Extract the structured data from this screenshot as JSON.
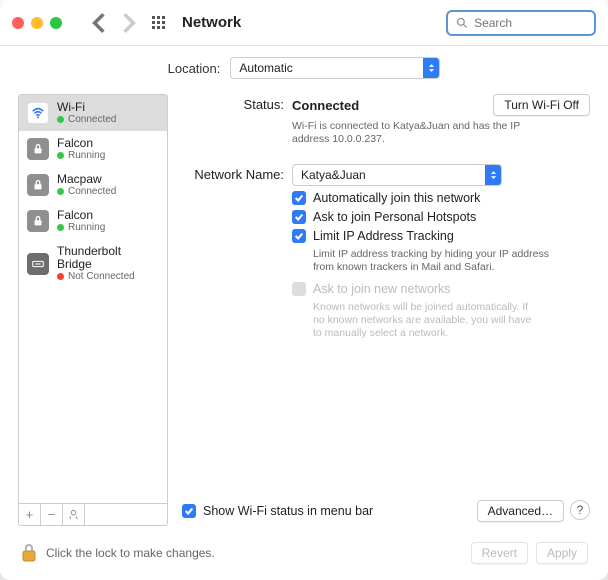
{
  "window": {
    "title": "Network"
  },
  "search": {
    "placeholder": "Search"
  },
  "location": {
    "label": "Location:",
    "value": "Automatic"
  },
  "services": [
    {
      "name": "Wi-Fi",
      "status": "Connected",
      "dot": "green",
      "icon": "wifi",
      "selected": true
    },
    {
      "name": "Falcon",
      "status": "Running",
      "dot": "green",
      "icon": "lock",
      "selected": false
    },
    {
      "name": "Macpaw",
      "status": "Connected",
      "dot": "green",
      "icon": "lock",
      "selected": false
    },
    {
      "name": "Falcon",
      "status": "Running",
      "dot": "green",
      "icon": "lock",
      "selected": false
    },
    {
      "name": "Thunderbolt Bridge",
      "status": "Not Connected",
      "dot": "red",
      "icon": "tb",
      "selected": false
    }
  ],
  "detail": {
    "status_label": "Status:",
    "status_value": "Connected",
    "toggle_button": "Turn Wi-Fi Off",
    "status_desc": "Wi-Fi is connected to Katya&Juan and has the IP address 10.0.0.237.",
    "network_label": "Network Name:",
    "network_value": "Katya&Juan",
    "opts": {
      "auto_join": "Automatically join this network",
      "ask_hotspot": "Ask to join Personal Hotspots",
      "limit_ip": "Limit IP Address Tracking",
      "limit_ip_desc": "Limit IP address tracking by hiding your IP address from known trackers in Mail and Safari.",
      "ask_new": "Ask to join new networks",
      "ask_new_desc": "Known networks will be joined automatically. If no known networks are available, you will have to manually select a network."
    },
    "show_menu": "Show Wi-Fi status in menu bar",
    "advanced": "Advanced…"
  },
  "footer": {
    "lock_text": "Click the lock to make changes.",
    "revert": "Revert",
    "apply": "Apply"
  }
}
